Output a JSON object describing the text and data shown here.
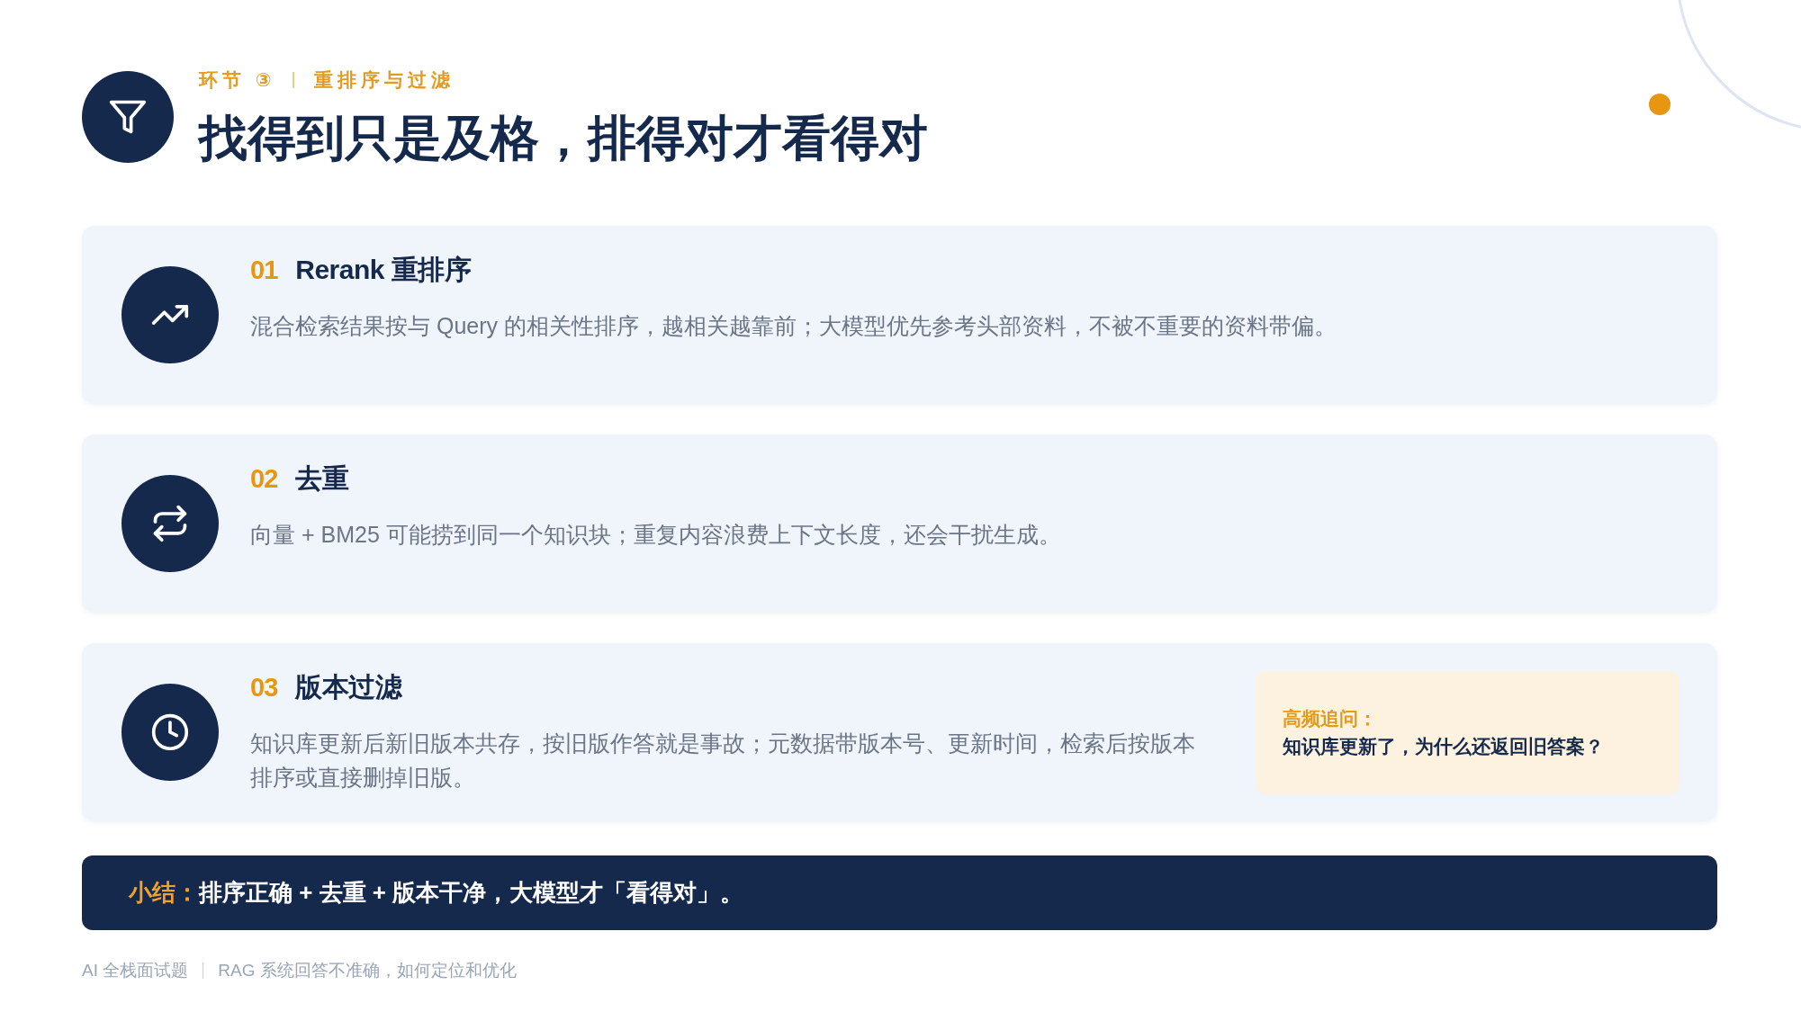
{
  "header": {
    "step_label": "环节 ③",
    "section": "重排序与过滤",
    "title": "找得到只是及格，排得对才看得对"
  },
  "cards": [
    {
      "kind": "trend",
      "number": "01",
      "title": "Rerank 重排序",
      "body": "混合检索结果按与 Query 的相关性排序，越相关越靠前；大模型优先参考头部资料，不被不重要的资料带偏。"
    },
    {
      "kind": "repeat",
      "number": "02",
      "title": "去重",
      "body": "向量 + BM25 可能捞到同一个知识块；重复内容浪费上下文长度，还会干扰生成。"
    },
    {
      "kind": "clock",
      "number": "03",
      "title": "版本过滤",
      "body": "知识库更新后新旧版本共存，按旧版作答就是事故；元数据带版本号、更新时间，检索后按版本排序或直接删掉旧版。",
      "callout": {
        "label": "高频追问：",
        "text": "知识库更新了，为什么还返回旧答案？"
      }
    }
  ],
  "summary": {
    "label": "小结：",
    "text": "排序正确 + 去重 + 版本干净，大模型才「看得对」。"
  },
  "footer": {
    "items": [
      "AI 全栈面试题",
      "RAG 系统回答不准确，如何定位和优化"
    ]
  }
}
